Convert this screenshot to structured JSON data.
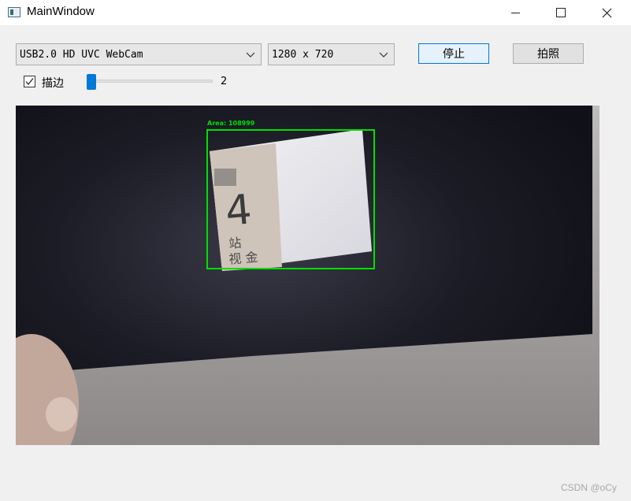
{
  "window": {
    "title": "MainWindow",
    "icon": "app-window-icon"
  },
  "toolbar": {
    "camera_select": {
      "value": "USB2.0 HD UVC WebCam"
    },
    "resolution_select": {
      "value": "1280 x 720"
    },
    "stop_label": "停止",
    "photo_label": "拍照"
  },
  "options": {
    "outline_label": "描边",
    "outline_checked": true,
    "thickness_value": "2",
    "thickness_slider_level": 0.0
  },
  "video": {
    "overlay_label": "Area: 108999",
    "box_color": "#00ff00"
  },
  "watermark": "CSDN @oCy"
}
